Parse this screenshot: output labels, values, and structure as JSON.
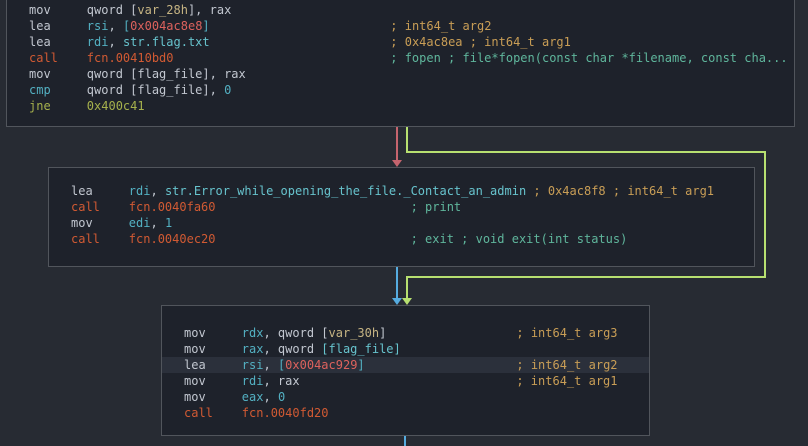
{
  "view": {
    "kind": "disassembly-graph"
  },
  "palette": {
    "bg": "#272b33",
    "blockbg": "#1e222b",
    "blockborder": "#51555c",
    "hlrow": "#2b303b",
    "p": "#c2c7d0",
    "r": "#53b0c2",
    "s": "#67c3cd",
    "c": "#d15a33",
    "h": "#dd625d",
    "g": "#c99e56",
    "t": "#5fb69c",
    "o": "#a6b14c",
    "v": "#c6b483"
  },
  "edges": {
    "false_branch": "#c5646e",
    "true_branch": "#b7e070",
    "unconditional": "#56ace0"
  },
  "blocks": [
    {
      "id": "entry-block",
      "lines": [
        {
          "highlight": false,
          "tokens": [
            [
              "mov     qword [",
              "p"
            ],
            [
              "var_28h",
              "v"
            ],
            [
              "], rax",
              "p"
            ]
          ]
        },
        {
          "highlight": false,
          "tokens": [
            [
              "lea     ",
              "p"
            ],
            [
              "rsi",
              "r"
            ],
            [
              ", ",
              "p"
            ],
            [
              "[",
              "r"
            ],
            [
              "0x004ac8e8",
              "h"
            ],
            [
              "]",
              "r"
            ],
            [
              "                         ",
              "p"
            ],
            [
              "; int64_t arg2",
              "g"
            ]
          ]
        },
        {
          "highlight": false,
          "tokens": [
            [
              "lea     ",
              "p"
            ],
            [
              "rdi",
              "r"
            ],
            [
              ", ",
              "p"
            ],
            [
              "str.flag.txt",
              "s"
            ],
            [
              "                         ",
              "p"
            ],
            [
              "; 0x4ac8ea ; int64_t arg1",
              "g"
            ]
          ]
        },
        {
          "highlight": false,
          "tokens": [
            [
              "call    fcn.00410bd0",
              "c"
            ],
            [
              "                              ",
              "p"
            ],
            [
              "; fopen ; file*fopen(const char *filename, const cha...",
              "t"
            ]
          ]
        },
        {
          "highlight": false,
          "tokens": [
            [
              "mov     qword [flag_file], rax",
              "p"
            ]
          ]
        },
        {
          "highlight": false,
          "tokens": [
            [
              "cmp",
              "r"
            ],
            [
              "     qword [flag_file], ",
              "p"
            ],
            [
              "0",
              "r"
            ]
          ]
        },
        {
          "highlight": false,
          "tokens": [
            [
              "jne     0x400c41",
              "o"
            ]
          ]
        }
      ]
    },
    {
      "id": "error-block",
      "lines": [
        {
          "highlight": false,
          "tokens": [
            [
              "lea     ",
              "p"
            ],
            [
              "rdi",
              "r"
            ],
            [
              ", ",
              "p"
            ],
            [
              "str.Error_while_opening_the_file._Contact_an_admin",
              "s"
            ],
            [
              " ",
              "p"
            ],
            [
              "; 0x4ac8f8 ; int64_t arg1",
              "g"
            ]
          ]
        },
        {
          "highlight": false,
          "tokens": [
            [
              "call    fcn.0040fa60",
              "c"
            ],
            [
              "                           ",
              "p"
            ],
            [
              "; print",
              "t"
            ]
          ]
        },
        {
          "highlight": false,
          "tokens": [
            [
              "mov     ",
              "p"
            ],
            [
              "edi",
              "r"
            ],
            [
              ", ",
              "p"
            ],
            [
              "1",
              "r"
            ]
          ]
        },
        {
          "highlight": false,
          "tokens": [
            [
              "call    fcn.0040ec20",
              "c"
            ],
            [
              "                           ",
              "p"
            ],
            [
              "; exit ; void exit(int status)",
              "t"
            ]
          ]
        }
      ]
    },
    {
      "id": "print-flag-block",
      "lines": [
        {
          "highlight": false,
          "tokens": [
            [
              "mov     ",
              "p"
            ],
            [
              "rdx",
              "r"
            ],
            [
              ", qword [",
              "p"
            ],
            [
              "var_30h",
              "v"
            ],
            [
              "]",
              "p"
            ],
            [
              "                  ",
              "p"
            ],
            [
              "; int64_t arg3",
              "g"
            ]
          ]
        },
        {
          "highlight": false,
          "tokens": [
            [
              "mov     ",
              "p"
            ],
            [
              "rax",
              "r"
            ],
            [
              ", qword ",
              "p"
            ],
            [
              "[flag_file]",
              "s"
            ]
          ]
        },
        {
          "highlight": true,
          "tokens": [
            [
              "lea     ",
              "p"
            ],
            [
              "rsi",
              "r"
            ],
            [
              ", ",
              "p"
            ],
            [
              "[",
              "r"
            ],
            [
              "0x004ac929",
              "h"
            ],
            [
              "]",
              "r"
            ],
            [
              "                     ",
              "p"
            ],
            [
              "; int64_t arg2",
              "g"
            ]
          ]
        },
        {
          "highlight": false,
          "tokens": [
            [
              "mov     ",
              "p"
            ],
            [
              "rdi",
              "r"
            ],
            [
              ", rax",
              "p"
            ],
            [
              "                              ",
              "p"
            ],
            [
              "; int64_t arg1",
              "g"
            ]
          ]
        },
        {
          "highlight": false,
          "tokens": [
            [
              "mov     ",
              "p"
            ],
            [
              "eax",
              "r"
            ],
            [
              ", ",
              "p"
            ],
            [
              "0",
              "r"
            ]
          ]
        },
        {
          "highlight": false,
          "tokens": [
            [
              "call    fcn.0040fd20",
              "c"
            ]
          ]
        }
      ]
    }
  ]
}
